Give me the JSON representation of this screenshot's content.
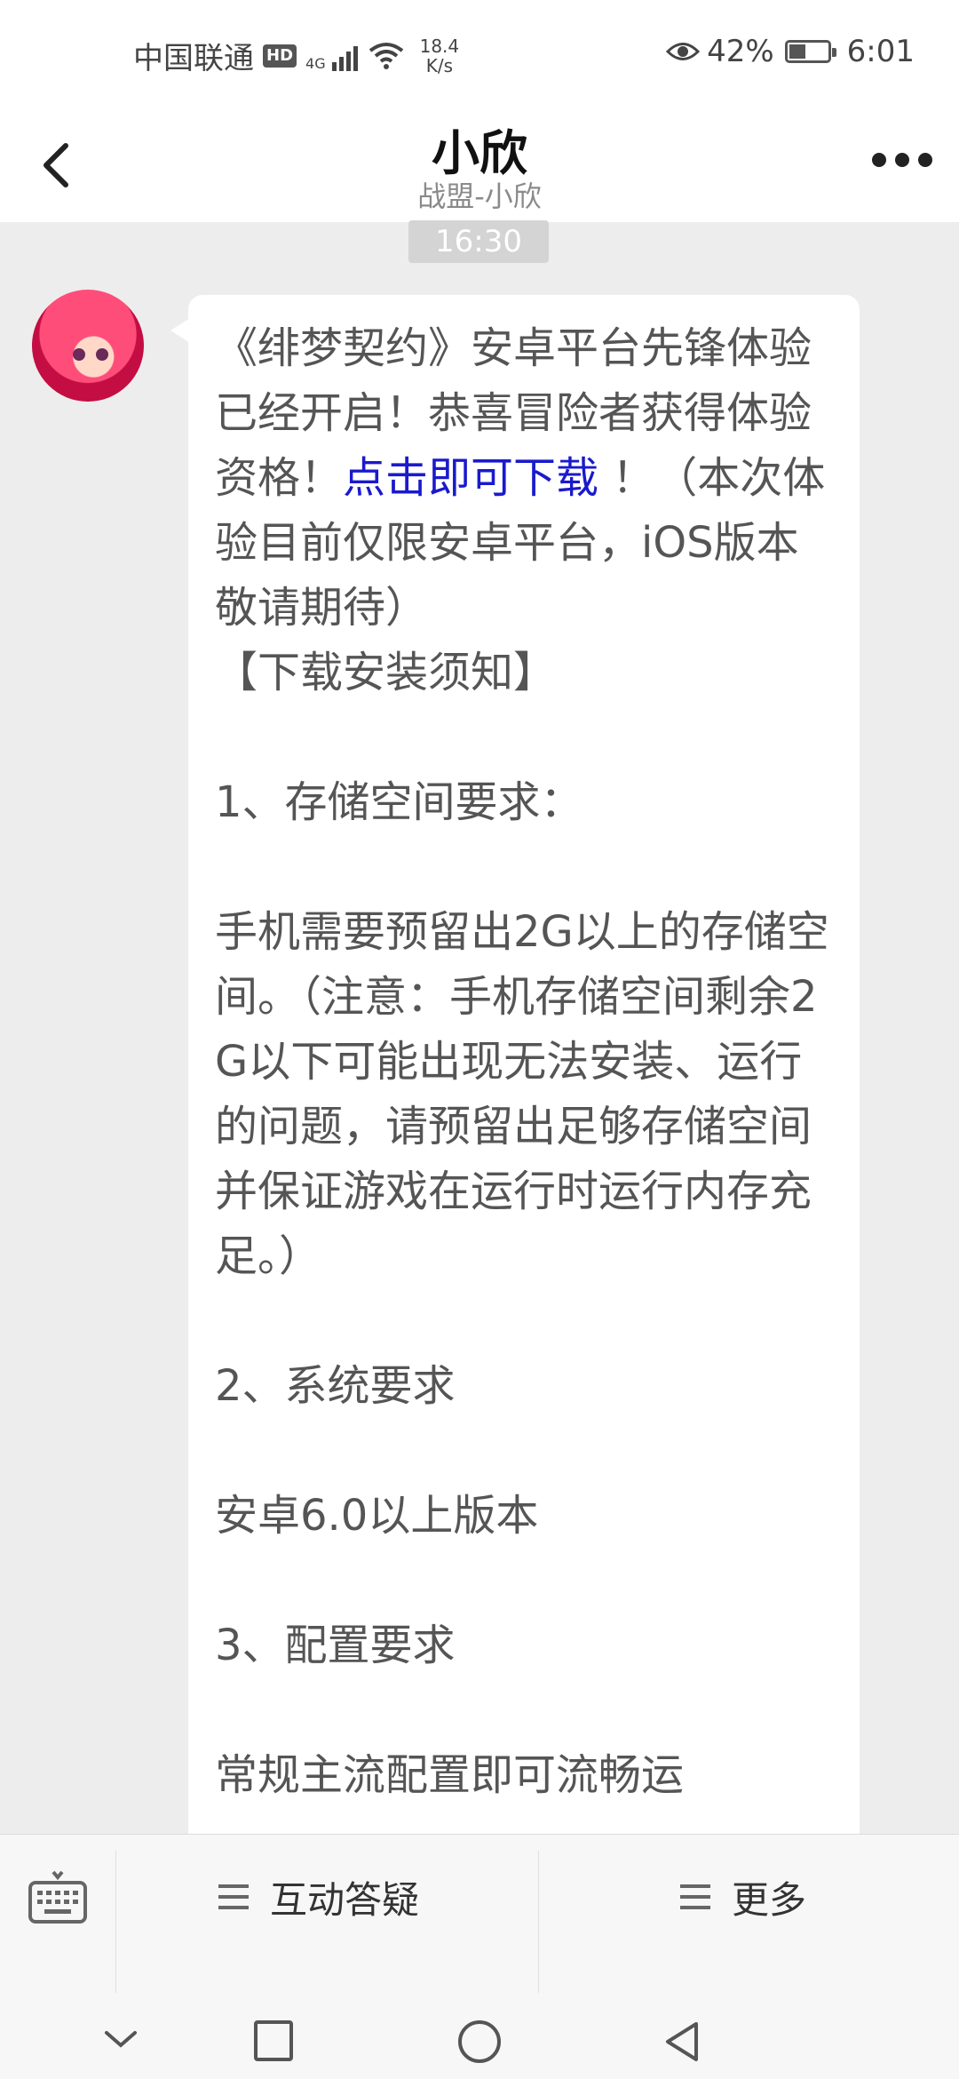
{
  "status_bar": {
    "carrier": "中国联通",
    "hd_badge": "HD",
    "network_type": "4G",
    "speed_value": "18.4",
    "speed_unit": "K/s",
    "battery": "42%",
    "battery_level": 0.42,
    "time": "6:01"
  },
  "header": {
    "title": "小欣",
    "subtitle": "战盟-小欣"
  },
  "chat": {
    "timestamp": "16:30",
    "message": {
      "part1": "《绯梦契约》安卓平台先锋体验已经开启！恭喜冒险者获得体验资格！",
      "link_text": "点击即可下载",
      "part2": " ！（本次体验目前仅限安卓平台，iOS版本敬请期待）\n【下载安装须知】\n\n1、存储空间要求：\n\n手机需要预留出2G以上的存储空间。（注意：手机存储空间剩余2G以下可能出现无法安装、运行的问题，请预留出足够存储空间并保证游戏在运行时运行内存充足。）\n\n2、系统要求\n\n安卓6.0以上版本\n\n3、配置要求\n\n常规主流配置即可流畅运"
    }
  },
  "bottom_menu": {
    "item1": "互动答疑",
    "item2": "更多"
  },
  "icons": {
    "back": "chevron-left-icon",
    "more": "more-dots-icon",
    "keyboard": "keyboard-icon",
    "menu": "hamburger-icon"
  }
}
